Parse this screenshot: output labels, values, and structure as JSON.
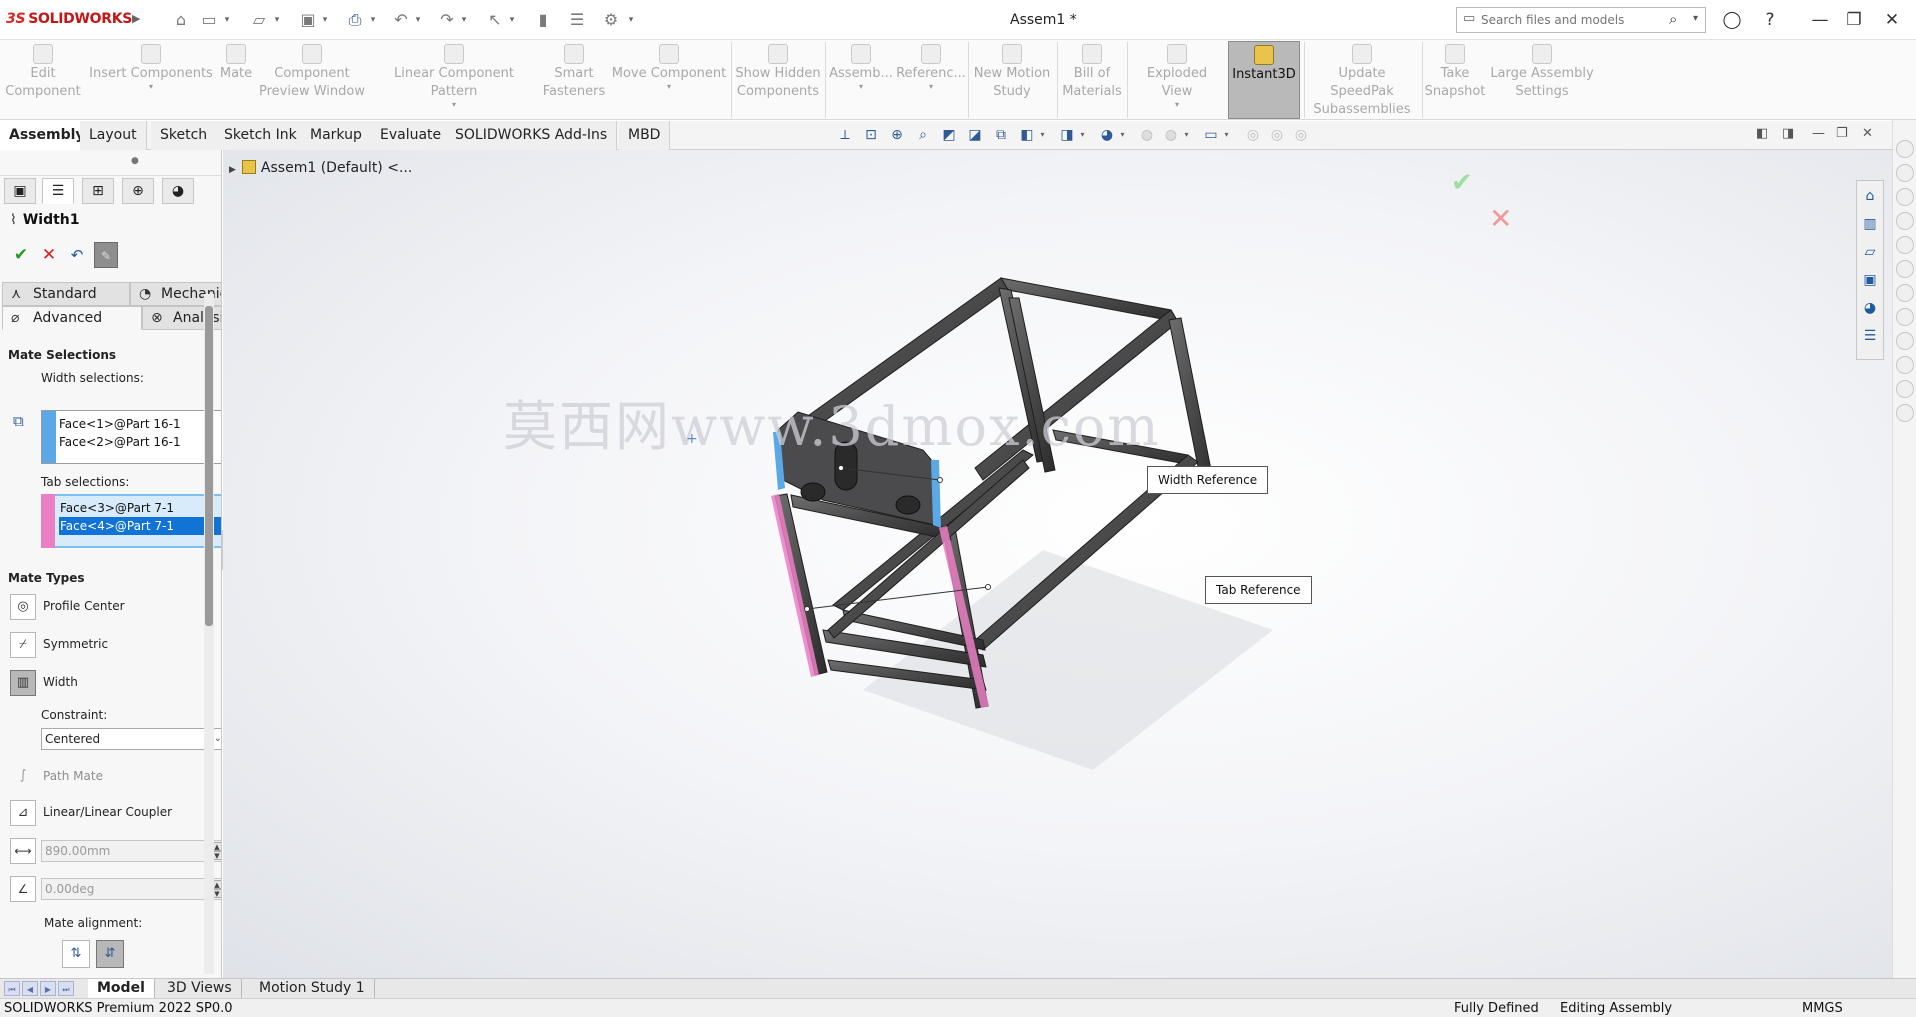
{
  "app": {
    "brand": "SOLIDWORKS",
    "brand_prefix": "3S",
    "title": "Assem1 *"
  },
  "search": {
    "placeholder": "Search files and models"
  },
  "command_manager": {
    "buttons": [
      {
        "id": "edit-component",
        "label": "Edit\nComponent"
      },
      {
        "id": "insert-components",
        "label": "Insert Components"
      },
      {
        "id": "mate",
        "label": "Mate"
      },
      {
        "id": "component-preview-window",
        "label": "Component\nPreview Window"
      },
      {
        "id": "linear-component-pattern",
        "label": "Linear Component Pattern"
      },
      {
        "id": "smart-fasteners",
        "label": "Smart\nFasteners"
      },
      {
        "id": "move-component",
        "label": "Move Component"
      },
      {
        "id": "show-hidden-components",
        "label": "Show Hidden\nComponents"
      },
      {
        "id": "assembly-features",
        "label": "Assemb..."
      },
      {
        "id": "reference-geometry",
        "label": "Referenc..."
      },
      {
        "id": "new-motion-study",
        "label": "New Motion\nStudy"
      },
      {
        "id": "bill-of-materials",
        "label": "Bill of\nMaterials"
      },
      {
        "id": "exploded-view",
        "label": "Exploded View"
      },
      {
        "id": "instant3d",
        "label": "Instant3D"
      },
      {
        "id": "update-speedpak",
        "label": "Update SpeedPak\nSubassemblies"
      },
      {
        "id": "take-snapshot",
        "label": "Take\nSnapshot"
      },
      {
        "id": "large-assembly-settings",
        "label": "Large Assembly\nSettings"
      }
    ],
    "tabs": [
      "Assembly",
      "Layout",
      "Sketch",
      "Sketch Ink",
      "Markup",
      "Evaluate",
      "SOLIDWORKS Add-Ins",
      "MBD"
    ]
  },
  "feature_tree": {
    "root": "Assem1 (Default) <..."
  },
  "property_manager": {
    "title": "Width1",
    "subtabs": {
      "standard": "Standard",
      "mechanical": "Mechanical",
      "advanced": "Advanced",
      "analysis": "Analysis"
    },
    "mate_selections": {
      "header": "Mate Selections",
      "width_label": "Width selections:",
      "width_items": [
        "Face<1>@Part 16-1",
        "Face<2>@Part 16-1"
      ],
      "tab_label": "Tab selections:",
      "tab_items": [
        "Face<3>@Part 7-1",
        "Face<4>@Part 7-1"
      ],
      "colors": {
        "width_bar": "#5aa9e6",
        "tab_bar": "#ea7fc4"
      }
    },
    "mate_types": {
      "header": "Mate Types",
      "profile_center": "Profile Center",
      "symmetric": "Symmetric",
      "width": "Width",
      "constraint_label": "Constraint:",
      "constraint_value": "Centered",
      "path_mate": "Path Mate",
      "linear_coupler": "Linear/Linear Coupler",
      "distance_value": "890.00mm",
      "angle_value": "0.00deg",
      "alignment_label": "Mate alignment:"
    }
  },
  "viewport": {
    "watermark": "莫西网www.3dmox.com",
    "callouts": {
      "width_ref": "Width Reference",
      "tab_ref": "Tab Reference"
    }
  },
  "bottom_tabs": [
    "Model",
    "3D Views",
    "Motion Study 1"
  ],
  "status": {
    "product": "SOLIDWORKS Premium 2022 SP0.0",
    "state": "Fully Defined",
    "mode": "Editing Assembly",
    "units": "MMGS"
  }
}
